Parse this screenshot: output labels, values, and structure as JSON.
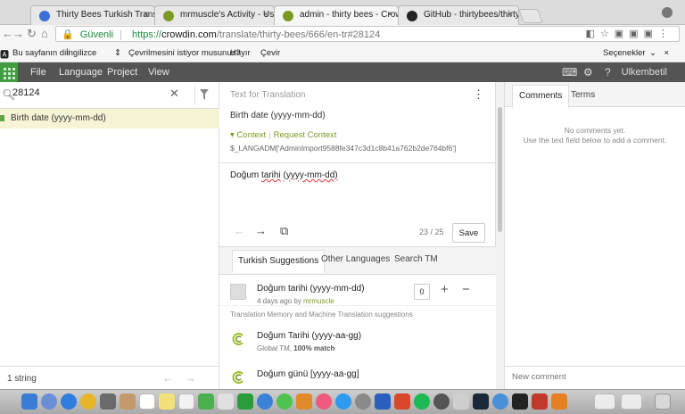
{
  "browser": {
    "tabs": [
      {
        "title": "Thirty Bees Turkish Translation",
        "close": "×",
        "favicon_color": "#3b6fd6"
      },
      {
        "title": "mrmuscle's Activity - Users at",
        "close": "×",
        "favicon_color": "#7a9a22"
      },
      {
        "title": "admin - thirty bees - Crowdin",
        "close": "×",
        "favicon_color": "#7a9a22"
      },
      {
        "title": "GitHub - thirtybees/thirtybees",
        "close": "×",
        "favicon_color": "#222222"
      }
    ],
    "address": {
      "secure_label": "Güvenli",
      "url_scheme": "https://",
      "url_host": "crowdin.com",
      "url_path": "/translate/thirty-bees/666/en-tr#28124"
    }
  },
  "translate_bar": {
    "prompt": "Bu sayfanın dili",
    "language": "İngilizce",
    "question": "Çevrilmesini istiyor musunuz?",
    "no": "Hayır",
    "yes": "Çevir",
    "options": "Seçenekler",
    "close": "×"
  },
  "crowdin_nav": {
    "menu": [
      "File",
      "Language",
      "Project",
      "View"
    ],
    "user": "Ulkembetil",
    "brand_color": "#3f9e3f"
  },
  "left_panel": {
    "search_value": "28124",
    "strings": [
      {
        "text": "Birth date (yyyy-mm-dd)"
      }
    ],
    "count": "1 string"
  },
  "editor": {
    "header": "Text for Translation",
    "source": "Birth date (yyyy-mm-dd)",
    "context_label": "Context",
    "request_context_label": "Request Context",
    "context_key": "$_LANGADM['AdminImport9588fe347c3d1c8b41a762b2de764bf6']",
    "translation_pre": "Doğum ",
    "translation_underlined": "tarihi",
    "translation_mid": " ",
    "translation_underlined2": "(yyyy-mm-dd)",
    "char_count": "23 / 25",
    "save_label": "Save"
  },
  "suggestions": {
    "tabs": [
      "Turkish Suggestions",
      "Other Languages",
      "Search TM"
    ],
    "user_suggestion": {
      "text": "Doğum tarihi (yyyy-mm-dd)",
      "time": "4 days ago by",
      "author": "mrmuscle",
      "votes": "0"
    },
    "tm_label": "Translation Memory and Machine Translation suggestions",
    "tm_items": [
      {
        "text": "Doğum Tarihi (yyyy-aa-gg)",
        "source": "Global TM,",
        "match": "100% match"
      },
      {
        "text": "Doğum günü [yyyy-aa-gg]",
        "source": "",
        "match": ""
      }
    ]
  },
  "comments": {
    "tabs": [
      "Comments",
      "Terms"
    ],
    "empty_line1": "No comments yet.",
    "empty_line2": "Use the text field below to add a comment.",
    "placeholder": "New comment"
  }
}
